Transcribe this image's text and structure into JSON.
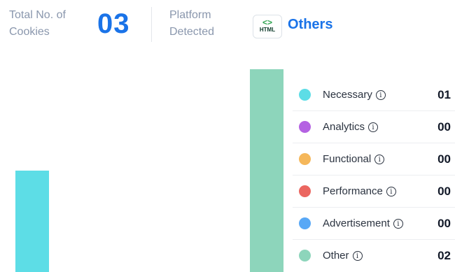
{
  "summary": {
    "total_label_line1": "Total No. of",
    "total_label_line2": "Cookies",
    "total_count": "03",
    "platform_label_line1": "Platform",
    "platform_label_line2": "Detected",
    "platform_icon": {
      "symbol": "<>",
      "text": "HTML",
      "name": "html-icon"
    },
    "platform_value": "Others"
  },
  "chart_data": {
    "type": "bar",
    "categories": [
      "Necessary",
      "Analytics",
      "Functional",
      "Performance",
      "Advertisement",
      "Other"
    ],
    "values": [
      1,
      0,
      0,
      0,
      0,
      2
    ],
    "colors": [
      "#5ddde6",
      "#b462e2",
      "#f5b75a",
      "#eb6660",
      "#58a8f6",
      "#8dd5bb"
    ],
    "ylim": [
      0,
      2
    ],
    "grid": false
  },
  "legend": {
    "info_symbol": "i",
    "items": [
      {
        "label": "Necessary",
        "value": "01",
        "color": "#5ddde6"
      },
      {
        "label": "Analytics",
        "value": "00",
        "color": "#b462e2"
      },
      {
        "label": "Functional",
        "value": "00",
        "color": "#f5b75a"
      },
      {
        "label": "Performance",
        "value": "00",
        "color": "#eb6660"
      },
      {
        "label": "Advertisement",
        "value": "00",
        "color": "#58a8f6"
      },
      {
        "label": "Other",
        "value": "02",
        "color": "#8dd5bb"
      }
    ]
  }
}
